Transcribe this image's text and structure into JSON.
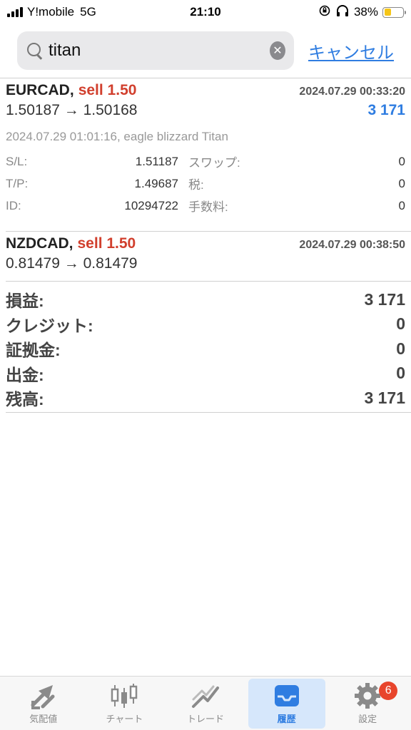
{
  "status_bar": {
    "carrier": "Y!mobile",
    "network": "5G",
    "time": "21:10",
    "battery": "38%",
    "battery_level": 0.38
  },
  "search": {
    "value": "titan",
    "placeholder": "",
    "cancel_label": "キャンセル"
  },
  "deals": [
    {
      "symbol": "EURCAD",
      "comma": ",",
      "side": "sell 1.50",
      "time": "2024.07.29 00:33:20",
      "prices": "1.50187 → 1.50168",
      "profit": "3 171",
      "comment": "2024.07.29 01:01:16, eagle blizzard Titan",
      "details": [
        {
          "label": "S/L:",
          "value": "1.51187",
          "label2": "スワップ:",
          "value2": "0"
        },
        {
          "label": "T/P:",
          "value": "1.49687",
          "label2": "税:",
          "value2": "0"
        },
        {
          "label": "ID:",
          "value": "10294722",
          "label2": "手数料:",
          "value2": "0"
        }
      ]
    },
    {
      "symbol": "NZDCAD",
      "comma": ",",
      "side": "sell 1.50",
      "time": "2024.07.29 00:38:50",
      "prices": "0.81479 → 0.81479"
    }
  ],
  "summary": [
    {
      "label": "損益:",
      "value": "3 171"
    },
    {
      "label": "クレジット:",
      "value": "0"
    },
    {
      "label": "証拠金:",
      "value": "0"
    },
    {
      "label": "出金:",
      "value": "0"
    },
    {
      "label": "残高:",
      "value": "3 171"
    }
  ],
  "tabs": [
    {
      "label": "気配値",
      "icon": "quotes-arrows-icon",
      "active": false
    },
    {
      "label": "チャート",
      "icon": "candlestick-chart-icon",
      "active": false
    },
    {
      "label": "トレード",
      "icon": "trade-line-icon",
      "active": false
    },
    {
      "label": "履歴",
      "icon": "inbox-tray-icon",
      "active": true
    },
    {
      "label": "設定",
      "icon": "gear-icon",
      "active": false,
      "badge": "6"
    }
  ],
  "colors": {
    "accent": "#2f7de1",
    "sell": "#d13f2d",
    "badge": "#e8452c"
  }
}
